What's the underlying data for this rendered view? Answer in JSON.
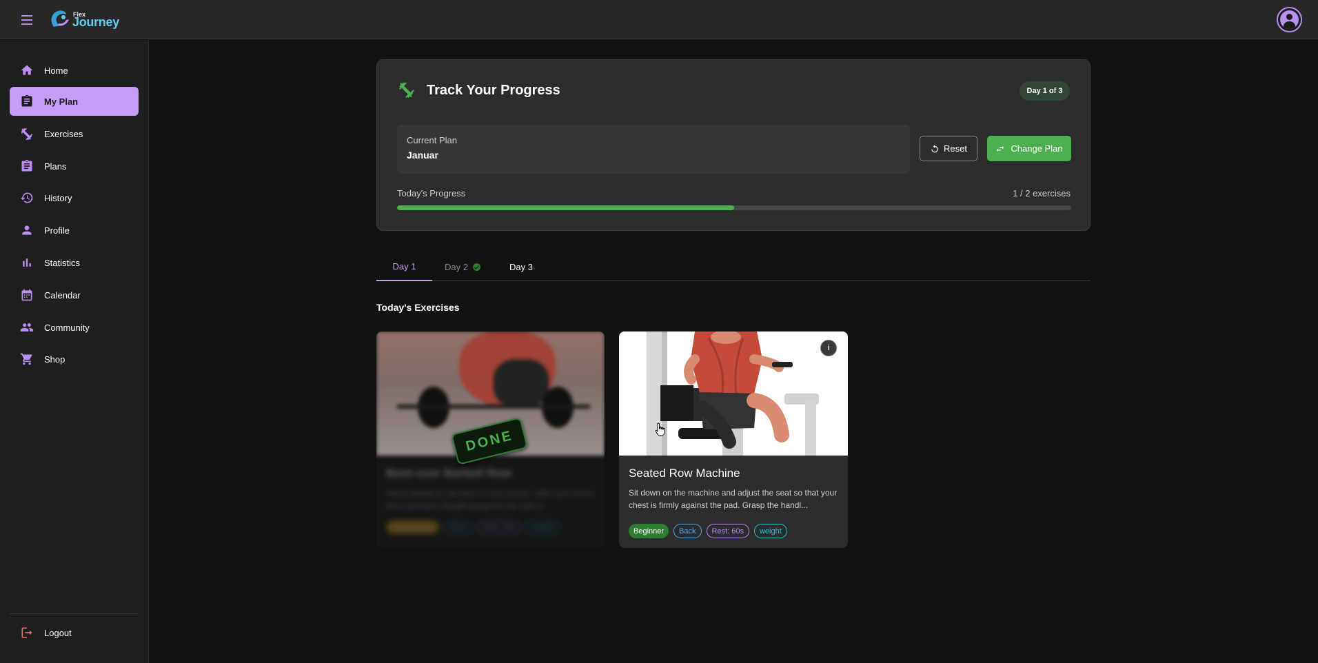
{
  "app": {
    "logo_small": "Flex",
    "logo_big": "Journey"
  },
  "sidebar": {
    "items": [
      {
        "label": "Home",
        "icon": "home-icon"
      },
      {
        "label": "My Plan",
        "icon": "clipboard-icon",
        "active": true
      },
      {
        "label": "Exercises",
        "icon": "dumbbell-icon"
      },
      {
        "label": "Plans",
        "icon": "clipboard-list-icon"
      },
      {
        "label": "History",
        "icon": "history-icon"
      },
      {
        "label": "Profile",
        "icon": "person-icon"
      },
      {
        "label": "Statistics",
        "icon": "bar-chart-icon"
      },
      {
        "label": "Calendar",
        "icon": "calendar-icon"
      },
      {
        "label": "Community",
        "icon": "people-icon"
      },
      {
        "label": "Shop",
        "icon": "cart-icon"
      }
    ],
    "logout_label": "Logout"
  },
  "progress_card": {
    "title": "Track Your Progress",
    "day_badge": "Day 1 of 3",
    "current_plan_caption": "Current Plan",
    "current_plan_value": "Januar",
    "reset_label": "Reset",
    "change_plan_label": "Change Plan",
    "progress_label": "Today's Progress",
    "progress_count": "1 / 2 exercises",
    "progress_fraction": 0.5
  },
  "tabs": [
    {
      "label": "Day 1",
      "active": true
    },
    {
      "label": "Day 2",
      "completed": true
    },
    {
      "label": "Day 3"
    }
  ],
  "section_title": "Today's Exercises",
  "exercises": [
    {
      "title": "Bent-over Barbell Row",
      "description": "Place barbell on the floor in front of you. With your knees bent and back straight grasp the bar with a...",
      "tags": [
        "Intermediate",
        "Back",
        "Rest: 60s",
        "weight"
      ],
      "done": true,
      "done_label": "DONE"
    },
    {
      "title": "Seated Row Machine",
      "description": "Sit down on the machine and adjust the seat so that your chest is firmly against the pad. Grasp the handl...",
      "tags": [
        "Beginner",
        "Back",
        "Rest: 60s",
        "weight"
      ],
      "done": false,
      "info_icon": "info-icon"
    }
  ],
  "colors": {
    "accent": "#c69cf8",
    "success": "#4caf50",
    "background": "#121212",
    "card": "#2c2c2c"
  }
}
